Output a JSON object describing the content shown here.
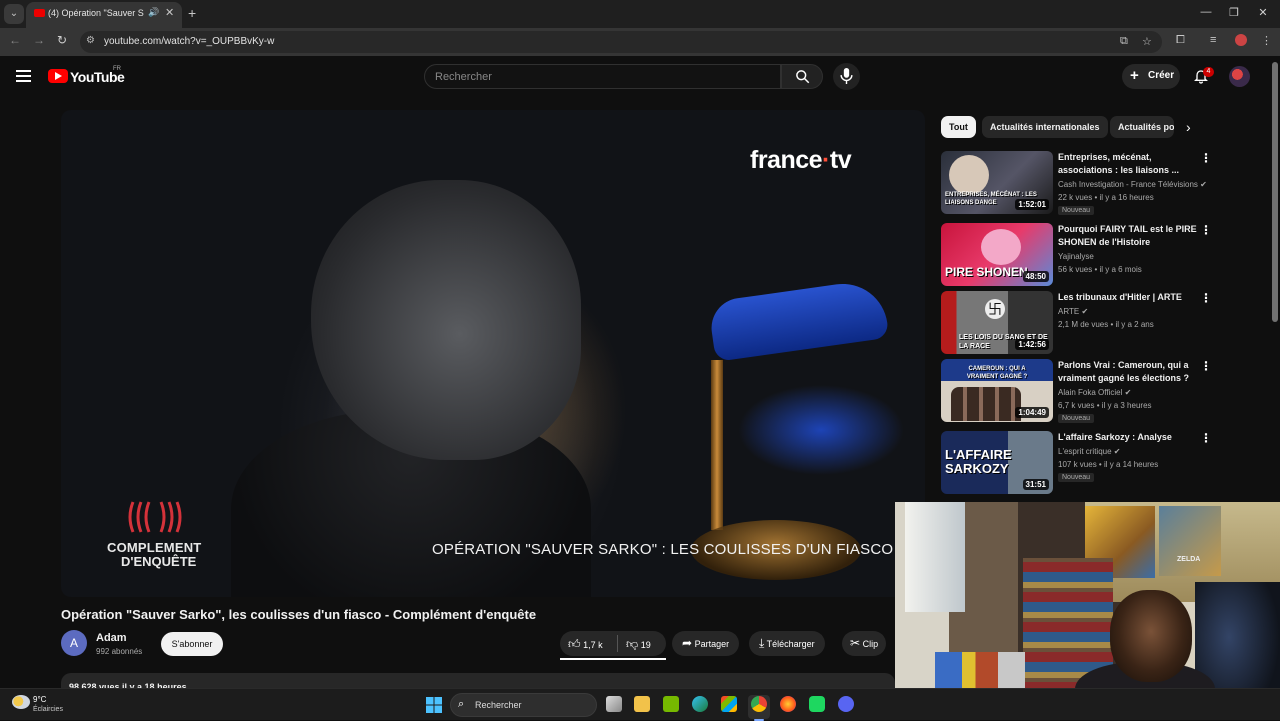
{
  "browser": {
    "tab_title": "(4) Opération \"Sauver Sarko\"",
    "url": "youtube.com/watch?v=_OUPBBvKy-w"
  },
  "header": {
    "logo_text": "YouTube",
    "country": "FR",
    "search_placeholder": "Rechercher",
    "create_label": "Créer",
    "notification_count": "4"
  },
  "player": {
    "broadcaster": "france",
    "broadcaster_suffix": "tv",
    "show_logo_line1": "COMPLEMENT",
    "show_logo_line2": "D'ENQUÊTE",
    "caption": "OPÉRATION \"SAUVER SARKO\" : LES COULISSES D'UN FIASCO"
  },
  "video": {
    "title": "Opération \"Sauver Sarko\", les coulisses d'un fiasco - Complément d'enquête",
    "channel_initial": "A",
    "channel_name": "Adam",
    "subscribers": "992 abonnés",
    "subscribe_label": "S'abonner",
    "likes": "1,7 k",
    "dislikes": "19",
    "share_label": "Partager",
    "download_label": "Télécharger",
    "clip_label": "Clip",
    "views_date": "98 628 vues  il y a 18 heures"
  },
  "sidebar": {
    "chips": [
      "Tout",
      "Actualités internationales",
      "Actualités po"
    ],
    "videos": [
      {
        "title": "Entreprises, mécénat, associations : les liaisons ...",
        "channel": "Cash Investigation - France Télévisions",
        "meta": "22 k vues • il y a 16 heures",
        "duration": "1:52:01",
        "badge": "Nouveau",
        "thumb_text": "ENTREPRISES, MÉCÉNAT : LES LIAISONS DANGE"
      },
      {
        "title": "Pourquoi FAIRY TAIL est le PIRE SHONEN de l'Histoire",
        "channel": "Yajinalyse",
        "meta": "56 k vues • il y a 6 mois",
        "duration": "48:50",
        "thumb_text": "PIRE SHONEN"
      },
      {
        "title": "Les tribunaux d'Hitler | ARTE",
        "channel": "ARTE",
        "meta": "2,1 M de vues • il y a 2 ans",
        "duration": "1:42:56",
        "thumb_text": "LES LOIS DU SANG ET DE LA RACE"
      },
      {
        "title": "Parlons Vrai : Cameroun, qui a vraiment gagné les élections ?",
        "channel": "Alain Foka Officiel",
        "meta": "6,7 k vues • il y a 3 heures",
        "duration": "1:04:49",
        "badge": "Nouveau",
        "thumb_text": "CAMEROUN : QUI A VRAIMENT GAGNÉ ?"
      },
      {
        "title": "L'affaire Sarkozy : Analyse",
        "channel": "L'esprit critique",
        "meta": "107 k vues • il y a 14 heures",
        "duration": "31:51",
        "badge": "Nouveau",
        "thumb_text_line1": "L'AFFAIRE",
        "thumb_text_line2": "SARKOZY"
      }
    ]
  },
  "webcam": {
    "poster_text": "ZELDA"
  },
  "taskbar": {
    "temperature": "9°C",
    "weather": "Éclaircies",
    "search_placeholder": "Rechercher"
  },
  "colors": {
    "background": "#0f0f0f",
    "accent_red": "#ff0000",
    "chip_active": "#f1f1f1",
    "surface": "#272727"
  }
}
